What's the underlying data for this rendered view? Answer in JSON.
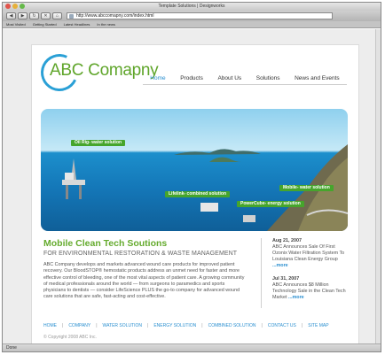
{
  "browser": {
    "title": "Template Solutions | Designworks",
    "url": "http://www.abccomapny.com/index.html",
    "bookmarks": [
      "Most Visited",
      "Getting Started",
      "Latest Headlines",
      "In the news"
    ],
    "status": "Done"
  },
  "logo": {
    "text": "ABC Comapny"
  },
  "nav": [
    {
      "label": "Home",
      "active": true
    },
    {
      "label": "Products"
    },
    {
      "label": "About Us"
    },
    {
      "label": "Solutions"
    },
    {
      "label": "News and Events"
    }
  ],
  "hero": {
    "labels": [
      "Oil Rig- water solution",
      "Lifelink- combined solution",
      "Mobile- water solution",
      "PowerCube- energy solution"
    ]
  },
  "content": {
    "headline": "Mobile Clean Tech Soutions",
    "subhead": "FOR ENVIRONMENTAL RESTORATION & WASTE MANAGEMENT",
    "body": "ABC Company develops and markets advanced wound care products for improved patient recovery. Our BloodSTOP® hemostatic products address an unmet need for faster and more effective control of bleeding, one of the most vital aspects of patient care. A growing community of medical professionals around the world — from surgeons to paramedics and sports physicians to dentists — consider LifeScience PLUS the go-to company for advanced wound care solutions that are safe, fast-acting and cost-effective."
  },
  "news": [
    {
      "date": "Aug 21, 2007",
      "text": "ABC Announces Sale Of First Ozonix Water Filtration System To Louisiana Clean Energy Group ",
      "more": "...more"
    },
    {
      "date": "Jul 31, 2007",
      "text": "ABC Announces $8 Million Technology Sale in the Clean Tech Market ",
      "more": "...more"
    }
  ],
  "footer": {
    "links": [
      "HOME",
      "COMPANY",
      "WATER SOLUTION",
      "ENERGY SOLUTION",
      "COMBINED SOLUTION",
      "CONTACT US",
      "SITE MAP"
    ],
    "copyright": "© Copyright 2008 ABC Inc."
  }
}
